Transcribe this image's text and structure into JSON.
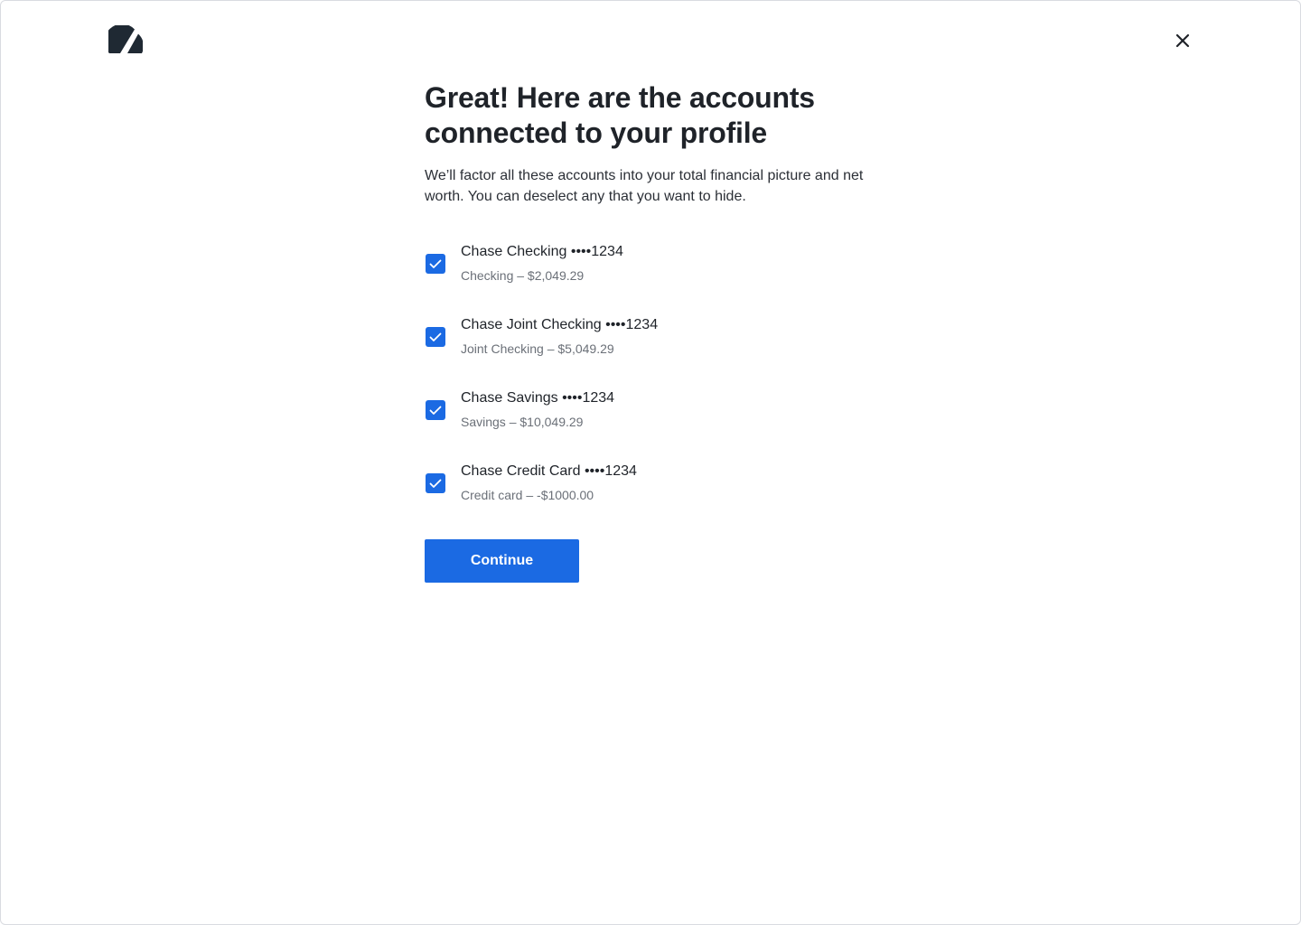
{
  "header": {
    "logo_icon": "slash-circle-logo-icon",
    "close_icon": "close-icon"
  },
  "main": {
    "title": "Great! Here are the accounts connected to your profile",
    "subtitle": "We’ll factor all these accounts into your total financial picture and net worth. You can deselect any that you want to hide.",
    "accounts": [
      {
        "name": "Chase Checking ••••1234",
        "detail": "Checking – $2,049.29",
        "checked": true
      },
      {
        "name": "Chase Joint Checking ••••1234",
        "detail": "Joint Checking – $5,049.29",
        "checked": true
      },
      {
        "name": "Chase Savings ••••1234",
        "detail": "Savings – $10,049.29",
        "checked": true
      },
      {
        "name": "Chase Credit Card ••••1234",
        "detail": "Credit card – -$1000.00",
        "checked": true
      }
    ],
    "continue_label": "Continue"
  },
  "colors": {
    "accent": "#1b6ae3",
    "text_primary": "#1f2329",
    "text_secondary": "#6b7078",
    "logo": "#1f2933"
  }
}
